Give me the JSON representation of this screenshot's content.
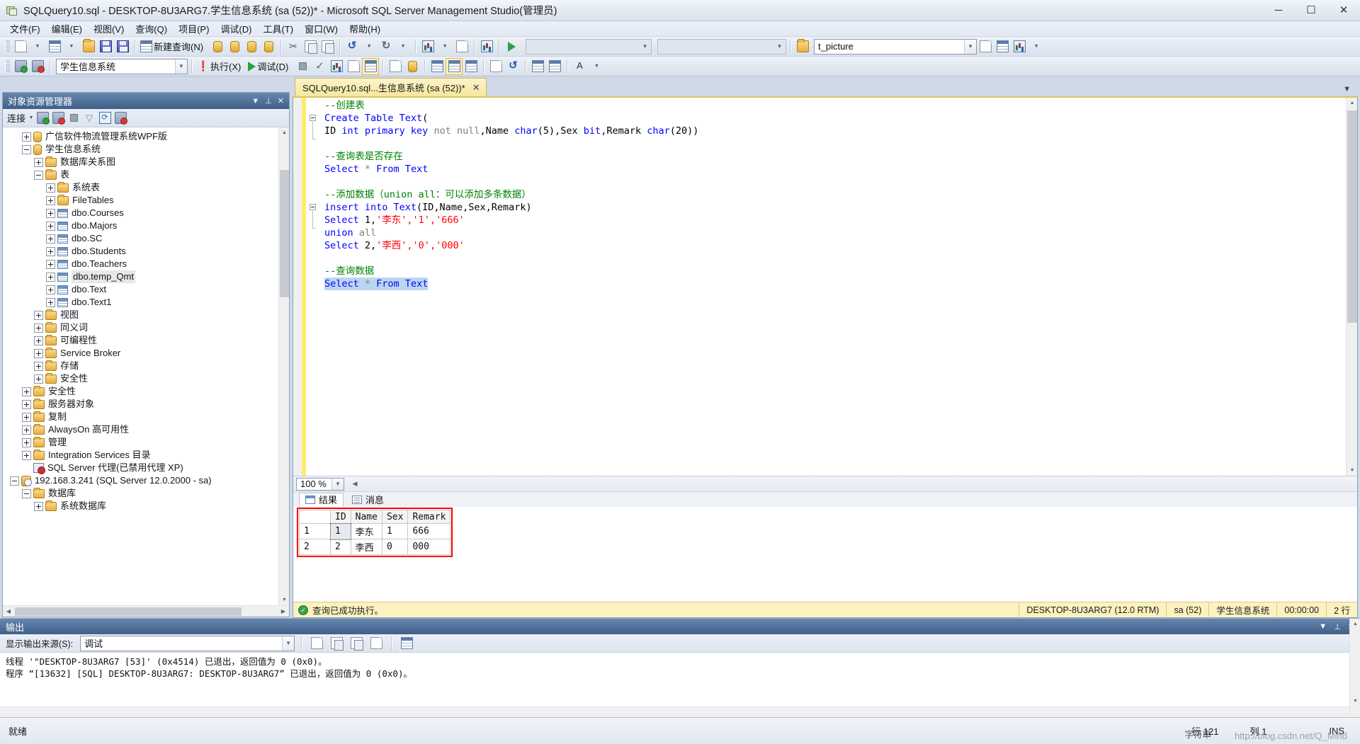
{
  "window": {
    "title": "SQLQuery10.sql - DESKTOP-8U3ARG7.学生信息系统 (sa (52))* - Microsoft SQL Server Management Studio(管理员)",
    "minimize": "─",
    "maximize": "☐",
    "close": "✕"
  },
  "menu": {
    "items": [
      {
        "label": "文件(F)"
      },
      {
        "label": "编辑(E)"
      },
      {
        "label": "视图(V)"
      },
      {
        "label": "查询(Q)"
      },
      {
        "label": "项目(P)"
      },
      {
        "label": "调试(D)"
      },
      {
        "label": "工具(T)"
      },
      {
        "label": "窗口(W)"
      },
      {
        "label": "帮助(H)"
      }
    ]
  },
  "toolbar1": {
    "new_query_label": "新建查询(N)",
    "combo_left_value": "",
    "combo_right_value": "",
    "find_value": "t_picture"
  },
  "toolbar2": {
    "database_value": "学生信息系统",
    "execute_label": "执行(X)",
    "debug_label": "调试(D)"
  },
  "object_explorer": {
    "title": "对象资源管理器",
    "connect_label": "连接",
    "tree": [
      {
        "level": 2,
        "icon": "dbcyl",
        "label": "广信软件物流管理系统WPF版",
        "expander": "plus"
      },
      {
        "level": 2,
        "icon": "dbcyl",
        "label": "学生信息系统",
        "expander": "minus"
      },
      {
        "level": 3,
        "icon": "folder",
        "label": "数据库关系图",
        "expander": "plus"
      },
      {
        "level": 3,
        "icon": "folder",
        "label": "表",
        "expander": "minus"
      },
      {
        "level": 4,
        "icon": "folder",
        "label": "系统表",
        "expander": "plus"
      },
      {
        "level": 4,
        "icon": "folder",
        "label": "FileTables",
        "expander": "plus"
      },
      {
        "level": 4,
        "icon": "table",
        "label": "dbo.Courses",
        "expander": "plus"
      },
      {
        "level": 4,
        "icon": "table",
        "label": "dbo.Majors",
        "expander": "plus"
      },
      {
        "level": 4,
        "icon": "table",
        "label": "dbo.SC",
        "expander": "plus"
      },
      {
        "level": 4,
        "icon": "table",
        "label": "dbo.Students",
        "expander": "plus"
      },
      {
        "level": 4,
        "icon": "table",
        "label": "dbo.Teachers",
        "expander": "plus"
      },
      {
        "level": 4,
        "icon": "table",
        "label": "dbo.temp_Qmt",
        "expander": "plus",
        "selected": true
      },
      {
        "level": 4,
        "icon": "table",
        "label": "dbo.Text",
        "expander": "plus"
      },
      {
        "level": 4,
        "icon": "table",
        "label": "dbo.Text1",
        "expander": "plus"
      },
      {
        "level": 3,
        "icon": "folder",
        "label": "视图",
        "expander": "plus"
      },
      {
        "level": 3,
        "icon": "folder",
        "label": "同义词",
        "expander": "plus"
      },
      {
        "level": 3,
        "icon": "folder",
        "label": "可编程性",
        "expander": "plus"
      },
      {
        "level": 3,
        "icon": "folder",
        "label": "Service Broker",
        "expander": "plus"
      },
      {
        "level": 3,
        "icon": "folder",
        "label": "存储",
        "expander": "plus"
      },
      {
        "level": 3,
        "icon": "folder",
        "label": "安全性",
        "expander": "plus"
      },
      {
        "level": 2,
        "icon": "folder",
        "label": "安全性",
        "expander": "plus"
      },
      {
        "level": 2,
        "icon": "folder",
        "label": "服务器对象",
        "expander": "plus"
      },
      {
        "level": 2,
        "icon": "folder",
        "label": "复制",
        "expander": "plus"
      },
      {
        "level": 2,
        "icon": "folder",
        "label": "AlwaysOn 高可用性",
        "expander": "plus"
      },
      {
        "level": 2,
        "icon": "folder",
        "label": "管理",
        "expander": "plus"
      },
      {
        "level": 2,
        "icon": "folder",
        "label": "Integration Services 目录",
        "expander": "plus"
      },
      {
        "level": 2,
        "icon": "agent",
        "label": "SQL Server 代理(已禁用代理 XP)",
        "expander": "none"
      },
      {
        "level": 1,
        "icon": "server",
        "label": "192.168.3.241 (SQL Server 12.0.2000 - sa)",
        "expander": "minus"
      },
      {
        "level": 2,
        "icon": "folder",
        "label": "数据库",
        "expander": "minus"
      },
      {
        "level": 3,
        "icon": "folder",
        "label": "系统数据库",
        "expander": "plus"
      }
    ]
  },
  "editor": {
    "tab_label": "SQLQuery10.sql...生信息系统 (sa (52))*",
    "tab_close": "✕",
    "zoom": "100 %",
    "lines": [
      {
        "segments": [
          {
            "t": "--创建表",
            "c": "cm"
          }
        ]
      },
      {
        "fold": "start",
        "segments": [
          {
            "t": "Create Table Text",
            "c": "kw"
          },
          {
            "t": "(",
            "c": "blk"
          }
        ]
      },
      {
        "segments": [
          {
            "t": "ID ",
            "c": "blk"
          },
          {
            "t": "int primary key ",
            "c": "kw"
          },
          {
            "t": "not null",
            "c": "gy"
          },
          {
            "t": ",Name ",
            "c": "blk"
          },
          {
            "t": "char",
            "c": "kw"
          },
          {
            "t": "(5),Sex ",
            "c": "blk"
          },
          {
            "t": "bit",
            "c": "kw"
          },
          {
            "t": ",Remark ",
            "c": "blk"
          },
          {
            "t": "char",
            "c": "kw"
          },
          {
            "t": "(20))",
            "c": "blk"
          }
        ]
      },
      {
        "segments": []
      },
      {
        "segments": [
          {
            "t": "--查询表是否存在",
            "c": "cm"
          }
        ]
      },
      {
        "segments": [
          {
            "t": "Select ",
            "c": "kw"
          },
          {
            "t": "* ",
            "c": "gy"
          },
          {
            "t": "From Text",
            "c": "kw"
          }
        ]
      },
      {
        "segments": []
      },
      {
        "segments": [
          {
            "t": "--添加数据（union all：可以添加多条数据）",
            "c": "cm"
          }
        ]
      },
      {
        "fold": "start",
        "segments": [
          {
            "t": "insert into Text",
            "c": "kw"
          },
          {
            "t": "(ID,Name,Sex,Remark)",
            "c": "blk"
          }
        ]
      },
      {
        "segments": [
          {
            "t": "Select ",
            "c": "kw"
          },
          {
            "t": "1,",
            "c": "blk"
          },
          {
            "t": "'李东','1','666'",
            "c": "str"
          }
        ]
      },
      {
        "segments": [
          {
            "t": "union ",
            "c": "kw"
          },
          {
            "t": "all",
            "c": "gy"
          }
        ]
      },
      {
        "segments": [
          {
            "t": "Select ",
            "c": "kw"
          },
          {
            "t": "2,",
            "c": "blk"
          },
          {
            "t": "'李西','0','000'",
            "c": "str"
          }
        ]
      },
      {
        "segments": []
      },
      {
        "segments": [
          {
            "t": "--查询数据",
            "c": "cm"
          }
        ]
      },
      {
        "selected": true,
        "segments": [
          {
            "t": "Select ",
            "c": "kw"
          },
          {
            "t": "* ",
            "c": "gy"
          },
          {
            "t": "From Text",
            "c": "kw"
          }
        ]
      }
    ]
  },
  "results": {
    "tabs": [
      {
        "label": "结果",
        "icon": "grid-icon",
        "active": true
      },
      {
        "label": "消息",
        "icon": "message-icon",
        "active": false
      }
    ],
    "columns": [
      "",
      "ID",
      "Name",
      "Sex",
      "Remark"
    ],
    "rows": [
      {
        "row_number": "1",
        "cells": [
          "1",
          "李东",
          "1",
          "666"
        ]
      },
      {
        "row_number": "2",
        "cells": [
          "2",
          "李西",
          "0",
          "000"
        ]
      }
    ]
  },
  "doc_status": {
    "message": "查询已成功执行。",
    "server": "DESKTOP-8U3ARG7 (12.0 RTM)",
    "user": "sa (52)",
    "database": "学生信息系统",
    "duration": "00:00:00",
    "rows": "2 行"
  },
  "output": {
    "title": "输出",
    "source_label": "显示输出来源(S):",
    "source_value": "调试",
    "lines": [
      "线程 '\"DESKTOP-8U3ARG7 [53]' (0x4514) 已退出，返回值为 0 (0x0)。",
      "程序 “[13632] [SQL] DESKTOP-8U3ARG7: DESKTOP-8U3ARG7” 已退出，返回值为 0 (0x0)。"
    ]
  },
  "statusbar": {
    "ready": "就绪",
    "line_label": "行 121",
    "col_label": "列 1",
    "ime": "字符串",
    "ins": "INS",
    "watermark": "http://blog.csdn.net/Q_Mind"
  },
  "colors": {
    "accent": "#3f5f89",
    "tab_active": "#f6e79e",
    "keyword": "#0000ff",
    "comment": "#008000",
    "string": "#ff0000",
    "status_bar": "#fbf2c0",
    "highlight_box": "#ff0000"
  }
}
